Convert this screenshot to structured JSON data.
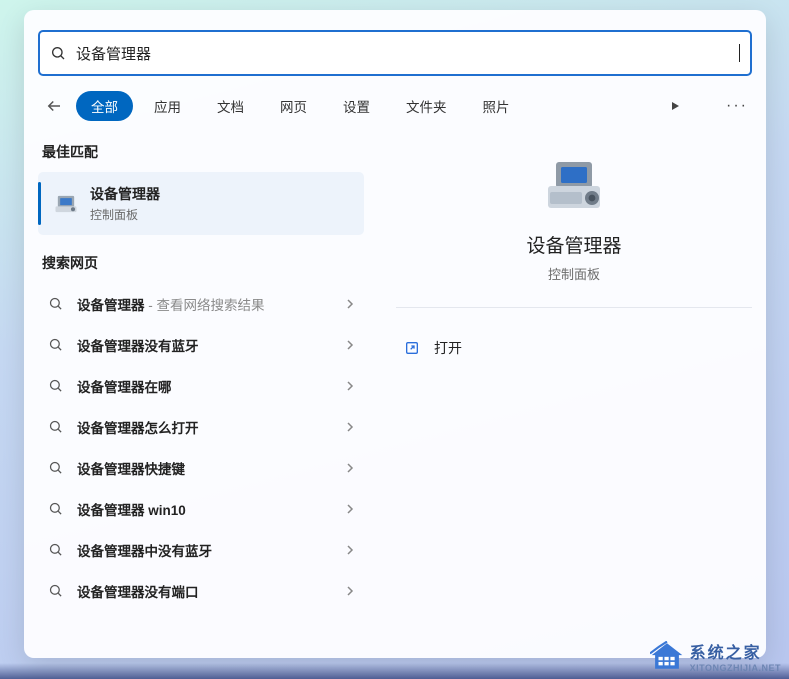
{
  "search": {
    "value": "设备管理器"
  },
  "tabs": {
    "items": [
      "全部",
      "应用",
      "文档",
      "网页",
      "设置",
      "文件夹",
      "照片"
    ],
    "selected_index": 0
  },
  "sections": {
    "best": "最佳匹配",
    "web": "搜索网页"
  },
  "best_match": {
    "title": "设备管理器",
    "subtitle": "控制面板"
  },
  "web_results": [
    {
      "label": "设备管理器",
      "suffix": " - 查看网络搜索结果"
    },
    {
      "label": "设备管理器没有蓝牙"
    },
    {
      "label": "设备管理器在哪"
    },
    {
      "label": "设备管理器怎么打开"
    },
    {
      "label": "设备管理器快捷键"
    },
    {
      "label": "设备管理器 win10"
    },
    {
      "label": "设备管理器中没有蓝牙"
    },
    {
      "label": "设备管理器没有端口"
    }
  ],
  "preview": {
    "title": "设备管理器",
    "subtitle": "控制面板",
    "actions": [
      {
        "label": "打开",
        "icon": "open-external-icon"
      }
    ]
  },
  "watermark": {
    "cn": "系统之家",
    "en": "XITONGZHIJIA.NET"
  }
}
